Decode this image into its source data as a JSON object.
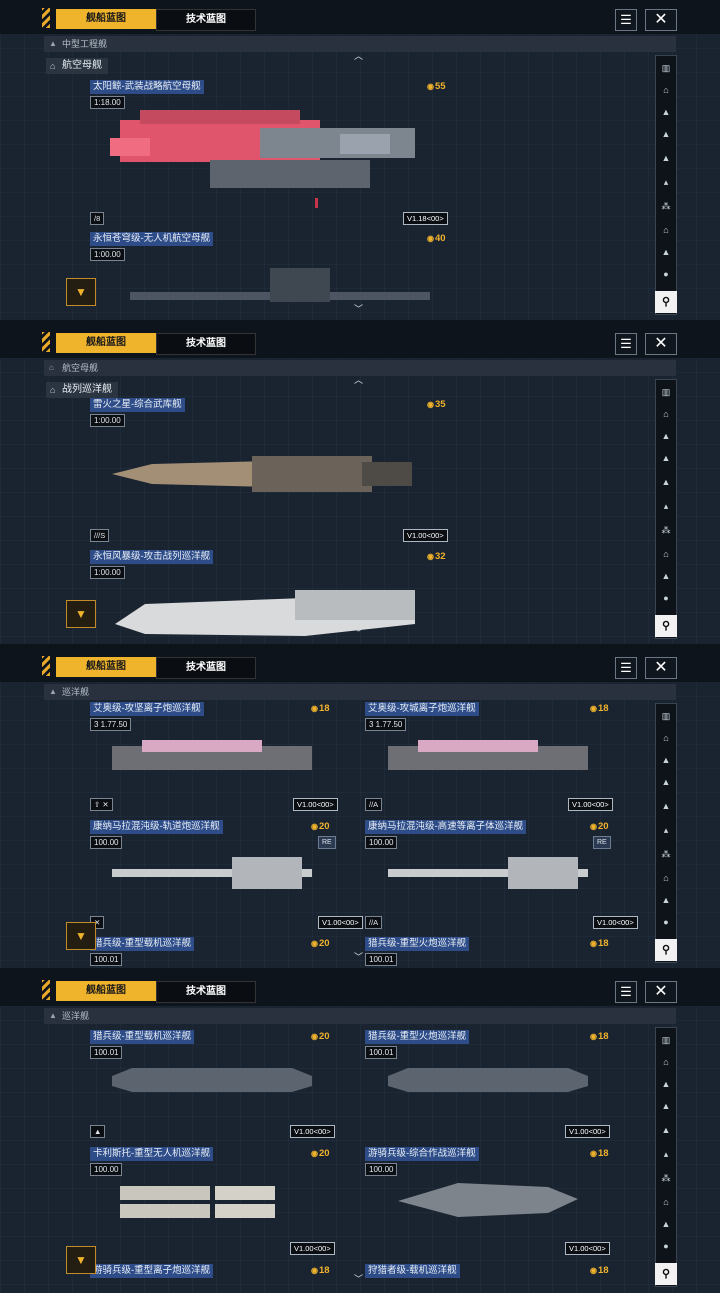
{
  "tabs": {
    "active": "舰船蓝图",
    "inactive": "技术蓝图"
  },
  "panels": [
    {
      "breadcrumb": "中型工程舰",
      "subheader": "航空母舰",
      "ships": [
        {
          "name": "太阳鲸-武装战略航空母舰",
          "cost": "55",
          "badge": "1:18.00",
          "tag": "/8",
          "version": "V1.18<00>"
        },
        {
          "name": "永恒苍穹级-无人机航空母舰",
          "cost": "40",
          "badge": "1:00.00"
        }
      ]
    },
    {
      "breadcrumb": "航空母舰",
      "subheader": "战列巡洋舰",
      "ships": [
        {
          "name": "雷火之星-综合武库舰",
          "cost": "35",
          "badge": "1:00.00",
          "tag": "///S",
          "version": "V1.00<00>"
        },
        {
          "name": "永恒风暴级-攻击战列巡洋舰",
          "cost": "32",
          "badge": "1:00.00"
        }
      ]
    },
    {
      "breadcrumb": "巡洋舰",
      "ships": [
        {
          "name": "艾奥级-攻坚离子炮巡洋舰",
          "cost": "18",
          "badge": "3  1.77.50",
          "version": "V1.00<00>"
        },
        {
          "name": "艾奥级-攻城离子炮巡洋舰",
          "cost": "18",
          "badge": "3  1.77.50",
          "tag": "//A",
          "version": "V1.00<00>"
        },
        {
          "name": "康纳马拉混沌级-轨道炮巡洋舰",
          "cost": "20",
          "badge": "100.00",
          "re": "RE",
          "version": "V1.00<00>"
        },
        {
          "name": "康纳马拉混沌级-高速等离子体巡洋舰",
          "cost": "20",
          "badge": "100.00",
          "re": "RE",
          "tag": "//A",
          "version": "V1.00<00>"
        },
        {
          "name": "猎兵级-重型载机巡洋舰",
          "cost": "20",
          "badge": "100.01"
        },
        {
          "name": "猎兵级-重型火炮巡洋舰",
          "cost": "18",
          "badge": "100.01"
        }
      ]
    },
    {
      "breadcrumb": "巡洋舰",
      "ships": [
        {
          "name": "猎兵级-重型载机巡洋舰",
          "cost": "20",
          "badge": "100.01",
          "version": "V1.00<00>"
        },
        {
          "name": "猎兵级-重型火炮巡洋舰",
          "cost": "18",
          "badge": "100.01",
          "version": "V1.00<00>"
        },
        {
          "name": "卡利斯托-重型无人机巡洋舰",
          "cost": "20",
          "badge": "100.00",
          "version": "V1.00<00>"
        },
        {
          "name": "游骑兵级-综合作战巡洋舰",
          "cost": "18",
          "badge": "100.00",
          "version": "V1.00<00>"
        },
        {
          "name": "游骑兵级-重型离子炮巡洋舰",
          "cost": "18"
        },
        {
          "name": "狩猎者级-载机巡洋舰",
          "cost": "18"
        }
      ]
    }
  ],
  "icons": {
    "close": "close-icon",
    "list": "list-icon",
    "filter": "filter-icon",
    "faction": "faction-emblem-icon",
    "cost": "resource-icon"
  },
  "colors": {
    "accent": "#f0b32c",
    "name_bg": "#2d4c88",
    "panel_bg": "#1a2330"
  }
}
